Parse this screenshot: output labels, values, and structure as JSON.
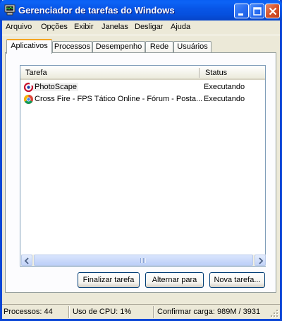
{
  "window": {
    "title": "Gerenciador de tarefas do Windows",
    "icon": "task-manager-icon",
    "accent": "#0A5FF4"
  },
  "menu": [
    "Arquivo",
    "Opções",
    "Exibir",
    "Janelas",
    "Desligar",
    "Ajuda"
  ],
  "tabs": [
    {
      "label": "Aplicativos",
      "active": true
    },
    {
      "label": "Processos",
      "active": false
    },
    {
      "label": "Desempenho",
      "active": false
    },
    {
      "label": "Rede",
      "active": false
    },
    {
      "label": "Usuários",
      "active": false
    }
  ],
  "list": {
    "columns": {
      "task": "Tarefa",
      "status": "Status"
    },
    "rows": [
      {
        "name": "PhotoScape",
        "status": "Executando",
        "icon": "photoscape-icon",
        "selected": true
      },
      {
        "name": "Cross Fire - FPS Tático Online - Fórum - Posta...",
        "status": "Executando",
        "icon": "chrome-icon",
        "selected": false
      }
    ]
  },
  "buttons": {
    "end_task": "Finalizar tarefa",
    "switch_to": "Alternar para",
    "new_task": "Nova tarefa..."
  },
  "statusbar": {
    "processes": "Processos: 44",
    "cpu": "Uso de CPU: 1%",
    "commit": "Confirmar carga: 989M / 3931"
  }
}
